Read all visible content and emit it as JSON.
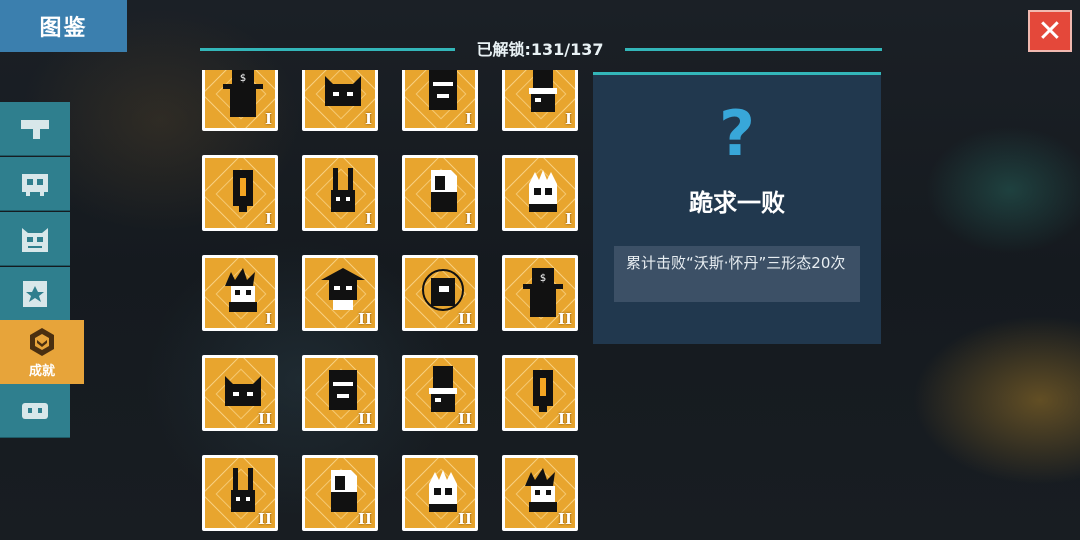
{
  "header": {
    "title": "图鉴",
    "unlock_text": "已解锁:131/137",
    "close_label": "✕"
  },
  "sidebar": {
    "items": [
      {
        "icon": "pistol-icon",
        "label": ""
      },
      {
        "icon": "skull-icon",
        "label": ""
      },
      {
        "icon": "boss-icon",
        "label": ""
      },
      {
        "icon": "star-card-icon",
        "label": ""
      },
      {
        "icon": "achievement-badge-icon",
        "label": "成就",
        "active": true
      },
      {
        "icon": "pet-icon",
        "label": ""
      }
    ]
  },
  "achievements": [
    {
      "icon": "hat-dollar-icon",
      "tier": "I"
    },
    {
      "icon": "cat-face-icon",
      "tier": "I"
    },
    {
      "icon": "box-robot-icon",
      "tier": "I"
    },
    {
      "icon": "chef-icon",
      "tier": "I"
    },
    {
      "icon": "lantern-icon",
      "tier": "I"
    },
    {
      "icon": "rabbit-icon",
      "tier": "I"
    },
    {
      "icon": "paper-icon",
      "tier": "I"
    },
    {
      "icon": "flame-skull-icon",
      "tier": "I"
    },
    {
      "icon": "spiky-hair-icon",
      "tier": "I"
    },
    {
      "icon": "pagoda-icon",
      "tier": "II"
    },
    {
      "icon": "diver-icon",
      "tier": "II"
    },
    {
      "icon": "hat-dollar-icon",
      "tier": "II"
    },
    {
      "icon": "cat-face-icon",
      "tier": "II"
    },
    {
      "icon": "box-robot-icon",
      "tier": "II"
    },
    {
      "icon": "chef-icon",
      "tier": "II"
    },
    {
      "icon": "lantern-icon",
      "tier": "II"
    },
    {
      "icon": "rabbit-icon",
      "tier": "II"
    },
    {
      "icon": "paper-icon",
      "tier": "II"
    },
    {
      "icon": "flame-skull-icon",
      "tier": "II"
    },
    {
      "icon": "spiky-hair-icon",
      "tier": "II"
    }
  ],
  "detail": {
    "icon": "question-mark-icon",
    "q_glyph": "?",
    "name": "跪求一败",
    "description": "累计击败“沃斯·怀丹”三形态20次"
  },
  "colors": {
    "accent": "#33b6b9",
    "card": "#e8a52e",
    "panel": "#21384e",
    "close": "#e4483a",
    "tab": "#2f7f8e",
    "active_tab": "#e7a43a"
  }
}
